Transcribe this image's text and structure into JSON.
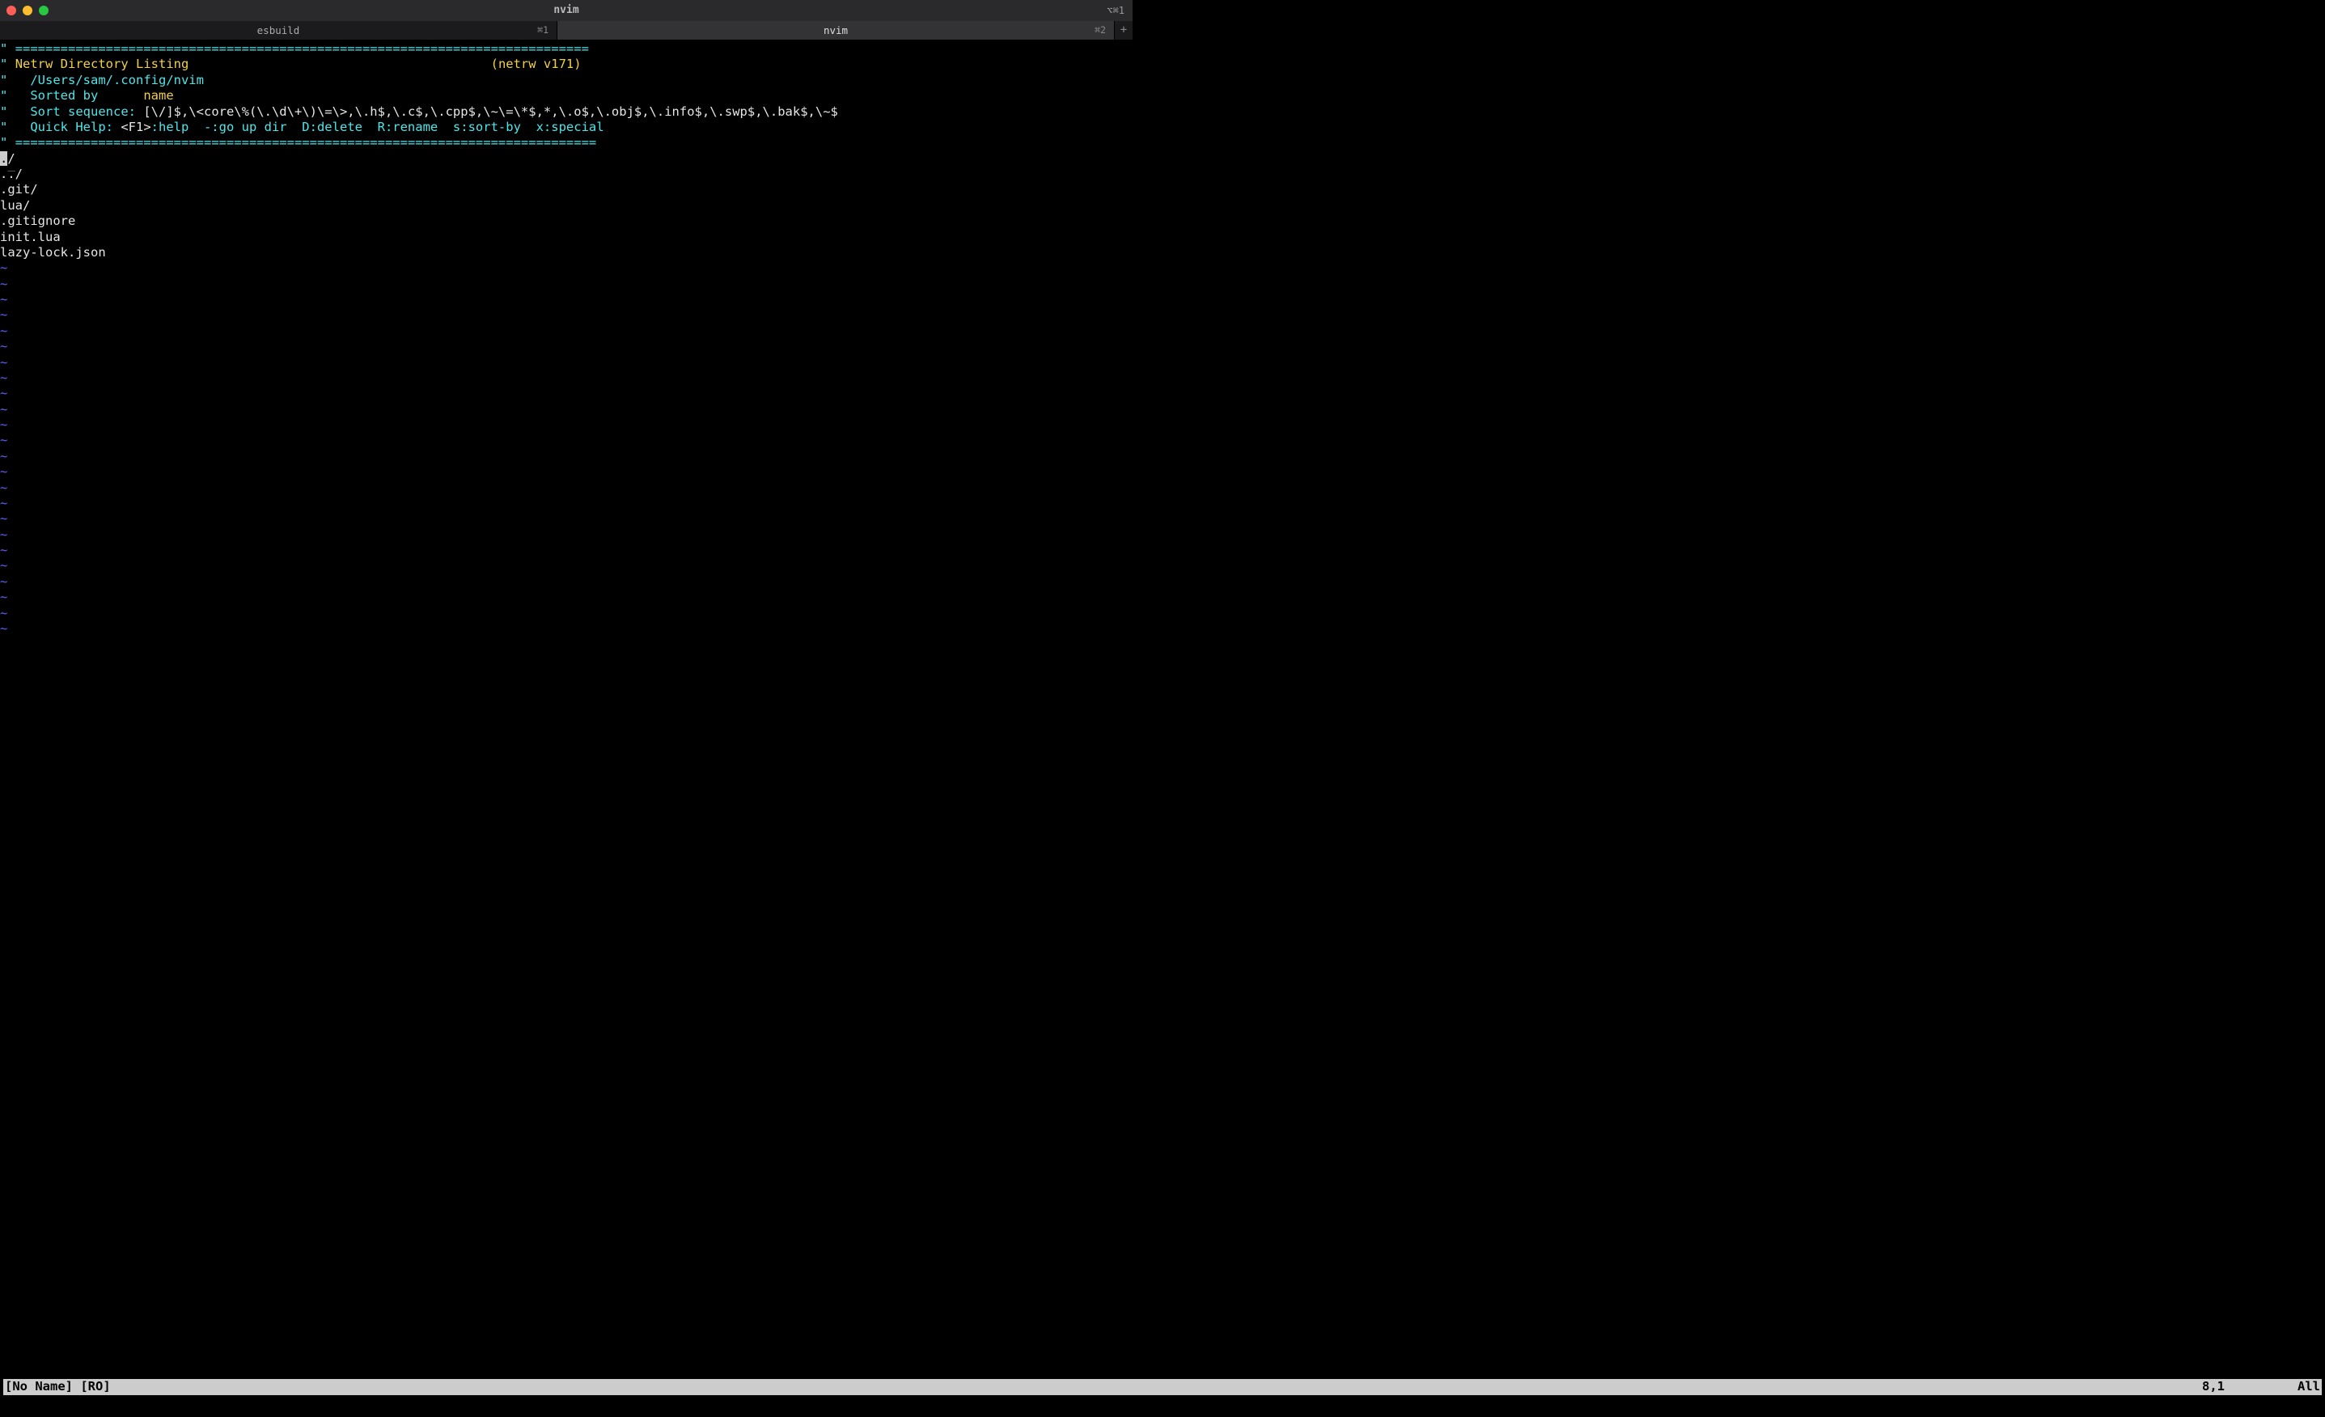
{
  "window": {
    "title": "nvim",
    "right_indicator": "⌥⌘1"
  },
  "tabs": [
    {
      "title": "esbuild",
      "shortcut": "⌘1",
      "active": false
    },
    {
      "title": "nvim",
      "shortcut": "⌘2",
      "active": true
    }
  ],
  "netrw": {
    "quote": "\"",
    "sep": "============================================================================",
    "title": "Netrw Directory Listing",
    "version": "(netrw v171)",
    "path_indent": "   ",
    "path": "/Users/sam/.config/nvim",
    "sorted_by_label": "   Sorted by      ",
    "sorted_by": "name",
    "sort_seq_label": "   Sort sequence: ",
    "sort_seq": "[\\/]$,\\<core\\%(\\.\\d\\+\\)\\=\\>,\\.h$,\\.c$,\\.cpp$,\\~\\=\\*$,*,\\.o$,\\.obj$,\\.info$,\\.swp$,\\.bak$,\\~$",
    "quick_help_label": "   Quick Help: ",
    "quick_help_key": "<F1>",
    "quick_help_rest": ":help  -:go up dir  D:delete  R:rename  s:sort-by  x:special",
    "sep2": "============================================================================="
  },
  "files": [
    "./",
    "../",
    ".git/",
    "lua/",
    ".gitignore",
    "init.lua",
    "lazy-lock.json"
  ],
  "cursor_file_first_char": ".",
  "cursor_file_rest": "/",
  "tilde_count": 24,
  "status": {
    "left": "[No Name] [RO]",
    "position": "8,1",
    "percent": "All"
  }
}
